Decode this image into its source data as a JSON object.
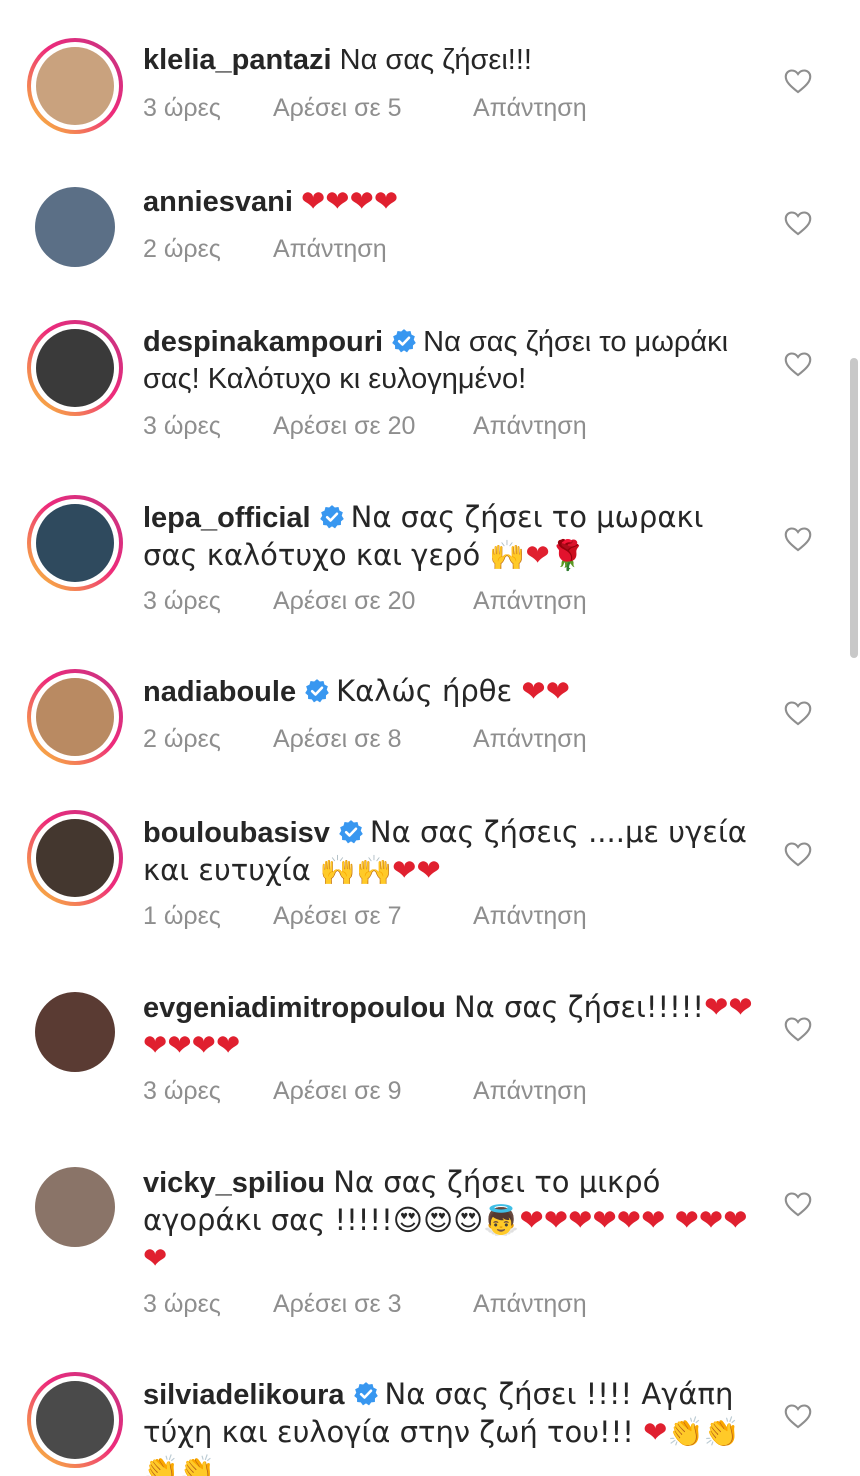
{
  "labels": {
    "reply": "Απάντηση"
  },
  "colors": {
    "meta_text": "#8e8e8e",
    "verified_blue": "#3897f0",
    "heart_emoji": "#e0202f",
    "story_ring_start": "#f9ce34",
    "story_ring_end": "#c13584"
  },
  "comments": [
    {
      "username": "klelia_pantazi",
      "verified": false,
      "story_ring": true,
      "text": "Να σας ζήσει!!!",
      "time": "3 ώρες",
      "likes": "Αρέσει σε 5",
      "reply": "Απάντηση",
      "avatar_color": "#c9a27e"
    },
    {
      "username": "anniesvani",
      "verified": false,
      "story_ring": false,
      "text": "❤❤❤❤",
      "time": "2 ώρες",
      "likes": "",
      "reply": "Απάντηση",
      "avatar_color": "#5b6f86"
    },
    {
      "username": "despinakampouri",
      "verified": true,
      "story_ring": true,
      "text": "Να σας ζήσει το μωράκι σας! Καλότυχο κι ευλογημένο!",
      "time": "3 ώρες",
      "likes": "Αρέσει σε 20",
      "reply": "Απάντηση",
      "avatar_color": "#3a3a3a"
    },
    {
      "username": "lepa_official",
      "verified": true,
      "story_ring": true,
      "text": "Να σας ζήσει το μωρακι σας καλότυχο και γερό 🙌❤🌹",
      "time": "3 ώρες",
      "likes": "Αρέσει σε 20",
      "reply": "Απάντηση",
      "avatar_color": "#2f4a5e"
    },
    {
      "username": "nadiaboule",
      "verified": true,
      "story_ring": true,
      "text": "Καλώς ήρθε ❤❤",
      "time": "2 ώρες",
      "likes": "Αρέσει σε 8",
      "reply": "Απάντηση",
      "avatar_color": "#b98a62"
    },
    {
      "username": "bouloubasisv",
      "verified": true,
      "story_ring": true,
      "text": "Να σας ζήσεις ....με υγεία και ευτυχία 🙌🙌❤❤",
      "time": "1 ώρες",
      "likes": "Αρέσει σε 7",
      "reply": "Απάντηση",
      "avatar_color": "#44372f"
    },
    {
      "username": "evgeniadimitropoulou",
      "verified": false,
      "story_ring": false,
      "text": "Να σας ζήσει!!!!!❤❤ ❤❤❤❤",
      "time": "3 ώρες",
      "likes": "Αρέσει σε 9",
      "reply": "Απάντηση",
      "avatar_color": "#5a3b33"
    },
    {
      "username": "vicky_spiliou",
      "verified": false,
      "story_ring": false,
      "text": "Να σας ζήσει το μικρό αγοράκι σας !!!!!😍😍😍👼❤❤❤❤❤❤ ❤❤❤❤",
      "time": "3 ώρες",
      "likes": "Αρέσει σε 3",
      "reply": "Απάντηση",
      "avatar_color": "#8a7468"
    },
    {
      "username": "silviadelikoura",
      "verified": true,
      "story_ring": true,
      "text": "Να σας ζήσει !!!! Αγάπη τύχη και ευλογία στην ζωή του!!! ❤👏👏 👏👏",
      "time": "",
      "likes": "",
      "reply": "",
      "avatar_color": "#4a4a4a"
    }
  ]
}
